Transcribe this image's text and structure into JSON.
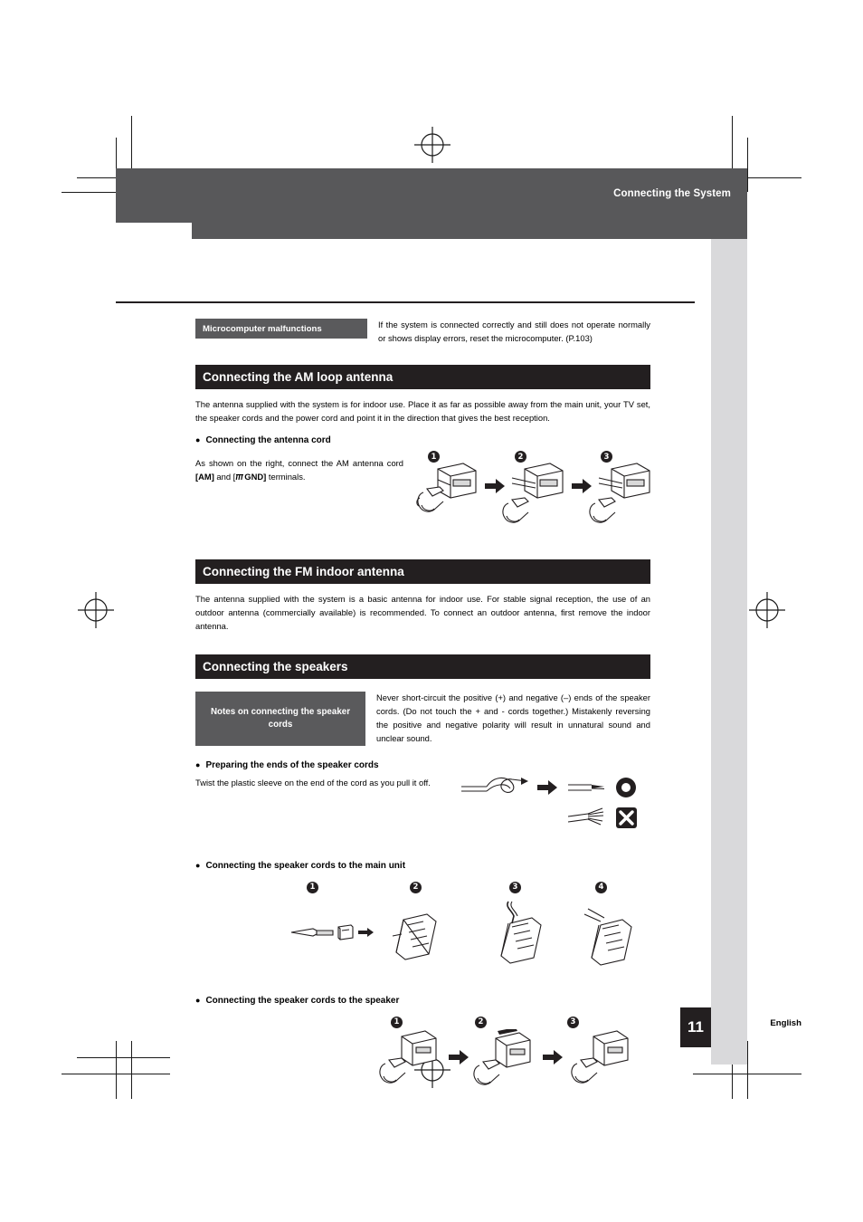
{
  "header": {
    "title": "Connecting the System"
  },
  "micro": {
    "label": "Microcomputer malfunctions",
    "text": "If the system is connected correctly and still does not operate normally or shows display errors, reset the microcomputer. (P.103)"
  },
  "sections": {
    "am": {
      "heading": "Connecting the AM loop antenna",
      "body": "The antenna supplied with the system is for indoor use. Place it as far as possible away from the main unit, your TV set, the speaker cords and the power cord and point it in the direction that gives the best reception.",
      "bullet": "Connecting the antenna cord",
      "sub": "As shown on the right, connect the AM antenna cord [AM] and [⏚ GND] terminals.",
      "sub_plain_1": "As shown on the right, connect the AM",
      "sub_plain_2": "antenna cord ",
      "sub_bold_am": "[AM]",
      "sub_plain_3": " and [",
      "sub_bold_gnd": "GND]",
      "sub_plain_4": " terminals.",
      "steps": [
        "1",
        "2",
        "3"
      ]
    },
    "fm": {
      "heading": "Connecting the FM indoor antenna",
      "body": "The antenna supplied with the system is a basic antenna for indoor use. For stable signal reception, the use of an outdoor antenna (commercially available) is recommended. To connect an outdoor antenna, first remove the indoor antenna."
    },
    "speakers": {
      "heading": "Connecting the speakers",
      "notes_label": "Notes on connecting the speaker cords",
      "notes_text": "Never short-circuit the positive (+) and negative (–) ends of the speaker cords. (Do not touch the + and - cords together.) Mistakenly reversing the positive and negative polarity will result in unnatural sound and unclear sound.",
      "bullet_prepare": "Preparing the ends of the speaker cords",
      "prepare_text": "Twist the plastic sleeve on the end of the cord as you pull it off.",
      "bullet_main_unit": "Connecting the speaker cords to the main unit",
      "main_unit_steps": [
        "1",
        "2",
        "3",
        "4"
      ],
      "bullet_speaker": "Connecting the speaker cords to the speaker",
      "speaker_steps": [
        "1",
        "2",
        "3"
      ]
    }
  },
  "footer": {
    "language": "English",
    "page_number": "11"
  }
}
